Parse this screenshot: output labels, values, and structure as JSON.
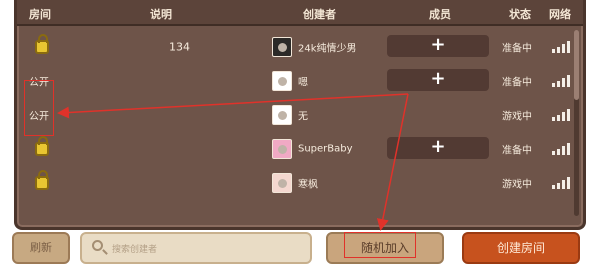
{
  "header": {
    "room": "房间",
    "desc": "说明",
    "creator": "创建者",
    "members": "成员",
    "status": "状态",
    "network": "网络"
  },
  "rows": [
    {
      "room_type": "lock",
      "room_text": "",
      "desc": "134",
      "creator": "24k纯情少男",
      "avatar": "dark",
      "join": "+",
      "status": "准备中",
      "signal_bars": 4
    },
    {
      "room_type": "text",
      "room_text": "公开",
      "desc": "",
      "creator": "嗯",
      "avatar": "white",
      "join": "+",
      "status": "准备中",
      "signal_bars": 4
    },
    {
      "room_type": "text",
      "room_text": "公开",
      "desc": "",
      "creator": "无",
      "avatar": "white",
      "join": "",
      "status": "游戏中",
      "signal_bars": 4
    },
    {
      "room_type": "lock",
      "room_text": "",
      "desc": "",
      "creator": "SuperBaby",
      "avatar": "pink",
      "join": "+",
      "status": "准备中",
      "signal_bars": 4
    },
    {
      "room_type": "lock",
      "room_text": "",
      "desc": "",
      "creator": "寒枫",
      "avatar": "red",
      "join": "",
      "status": "游戏中",
      "signal_bars": 4
    }
  ],
  "bottom": {
    "refresh": "刷新",
    "search_placeholder": "搜索创建者",
    "random_join": "随机加入",
    "create_room": "创建房间"
  },
  "colors": {
    "panel": "#6e5449",
    "header": "#5c443a",
    "annotation_red": "#e0322a",
    "create_button": "#c7521e"
  }
}
